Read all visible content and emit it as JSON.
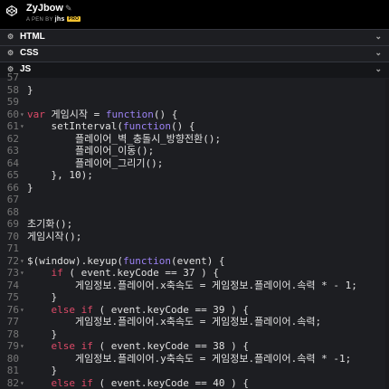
{
  "pen": {
    "title": "ZyJbow",
    "by_prefix": "A PEN BY",
    "author": "jhs",
    "badge": "PRO"
  },
  "panels": [
    {
      "label": "HTML"
    },
    {
      "label": "CSS"
    },
    {
      "label": "JS"
    }
  ],
  "code_lines": [
    {
      "n": "57",
      "fold": "",
      "html": ""
    },
    {
      "n": "58",
      "fold": "",
      "html": "}"
    },
    {
      "n": "59",
      "fold": "",
      "html": ""
    },
    {
      "n": "60",
      "fold": "▾",
      "html": "<span class=\"kw\">var</span> 게임시작 = <span class=\"fn\">function</span>() {"
    },
    {
      "n": "61",
      "fold": "▾",
      "html": "    setInterval(<span class=\"fn\">function</span>() {"
    },
    {
      "n": "62",
      "fold": "",
      "html": "        플레이어_벽_충돌시_방향전환();"
    },
    {
      "n": "63",
      "fold": "",
      "html": "        플레이어_이동();"
    },
    {
      "n": "64",
      "fold": "",
      "html": "        플레이어_그리기();"
    },
    {
      "n": "65",
      "fold": "",
      "html": "    }, 10);"
    },
    {
      "n": "66",
      "fold": "",
      "html": "}"
    },
    {
      "n": "67",
      "fold": "",
      "html": ""
    },
    {
      "n": "68",
      "fold": "",
      "html": ""
    },
    {
      "n": "69",
      "fold": "",
      "html": "초기화();"
    },
    {
      "n": "70",
      "fold": "",
      "html": "게임시작();"
    },
    {
      "n": "71",
      "fold": "",
      "html": ""
    },
    {
      "n": "72",
      "fold": "▾",
      "html": "$(window).keyup(<span class=\"fn\">function</span>(event) {"
    },
    {
      "n": "73",
      "fold": "▾",
      "html": "    <span class=\"kw\">if</span> ( event.keyCode == 37 ) {"
    },
    {
      "n": "74",
      "fold": "",
      "html": "        게임정보.플레이어.x축속도 = 게임정보.플레이어.속력 * - 1;"
    },
    {
      "n": "75",
      "fold": "",
      "html": "    }"
    },
    {
      "n": "76",
      "fold": "▾",
      "html": "    <span class=\"kw\">else if</span> ( event.keyCode == 39 ) {"
    },
    {
      "n": "77",
      "fold": "",
      "html": "        게임정보.플레이어.x축속도 = 게임정보.플레이어.속력;"
    },
    {
      "n": "78",
      "fold": "",
      "html": "    }"
    },
    {
      "n": "79",
      "fold": "▾",
      "html": "    <span class=\"kw\">else if</span> ( event.keyCode == 38 ) {"
    },
    {
      "n": "80",
      "fold": "",
      "html": "        게임정보.플레이어.y축속도 = 게임정보.플레이어.속력 * -1;"
    },
    {
      "n": "81",
      "fold": "",
      "html": "    }"
    },
    {
      "n": "82",
      "fold": "▾",
      "html": "    <span class=\"kw\">else if</span> ( event.keyCode == 40 ) {"
    }
  ]
}
